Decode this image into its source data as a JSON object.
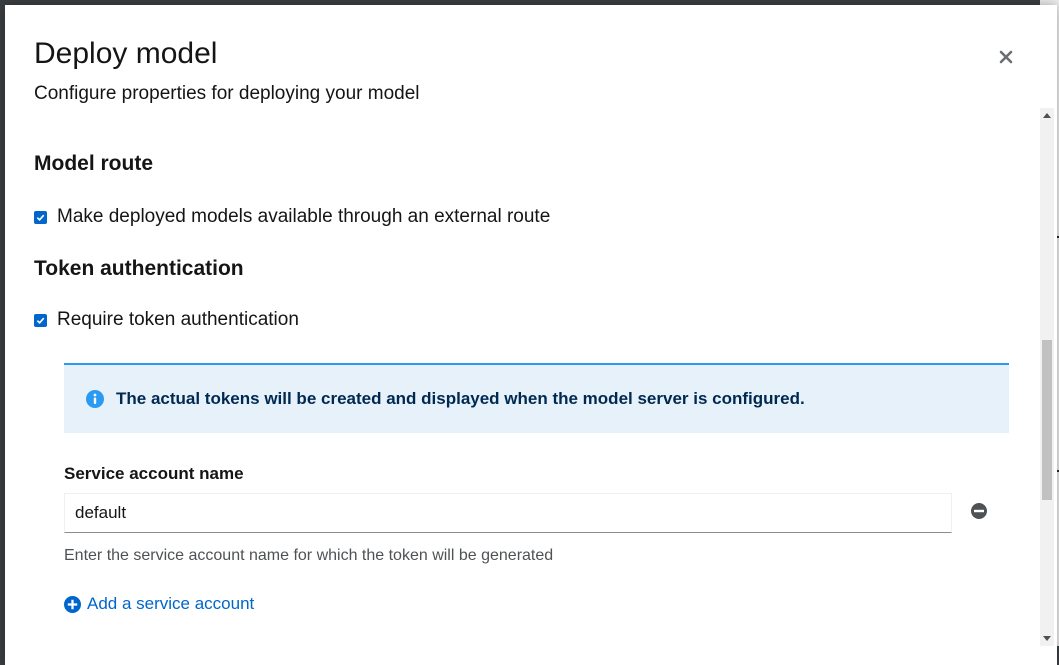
{
  "modal": {
    "title": "Deploy model",
    "description": "Configure properties for deploying your model",
    "close_icon": "close-icon"
  },
  "model_route": {
    "heading": "Model route",
    "checkbox_label": "Make deployed models available through an external route",
    "checked": true
  },
  "token_auth": {
    "heading": "Token authentication",
    "checkbox_label": "Require token authentication",
    "checked": true,
    "alert": {
      "icon": "info-circle-icon",
      "text": "The actual tokens will be created and displayed when the model server is configured."
    },
    "service_account": {
      "label": "Service account name",
      "value": "default",
      "helper_text": "Enter the service account name for which the token will be generated",
      "remove_icon": "minus-circle-icon"
    },
    "add_link": {
      "label": "Add a service account",
      "icon": "plus-circle-icon"
    }
  },
  "colors": {
    "primary": "#0066cc",
    "alert_bg": "#e7f1fa",
    "alert_border": "#2b9af3",
    "alert_text": "#002952"
  }
}
